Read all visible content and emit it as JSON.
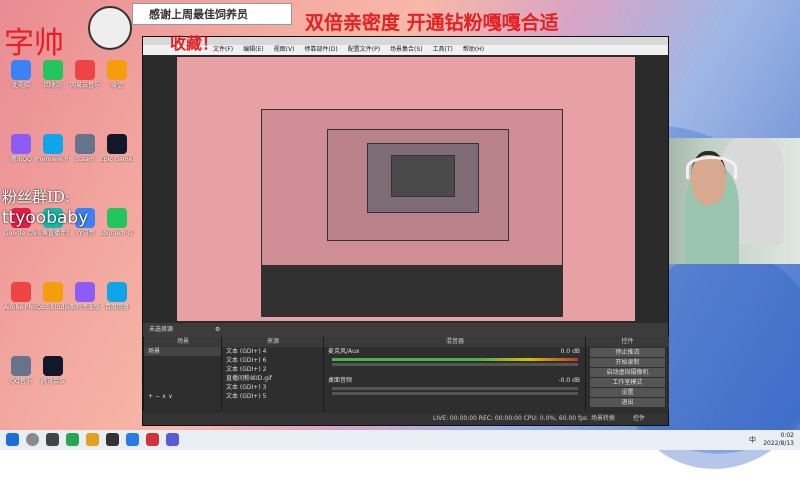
{
  "overlay": {
    "title": "双倍亲密度 开通钻粉嘎嘎合适",
    "banner": "感谢上周最佳饲养员",
    "zishuai": "字帅",
    "shoucang": "收藏！",
    "fans_label": "粉丝群ID:",
    "fans_id": "ttyoobaby"
  },
  "obs": {
    "menu": [
      "文件(F)",
      "编辑(E)",
      "视图(V)",
      "停靠部件(D)",
      "配置文件(P)",
      "场景集合(S)",
      "工具(T)",
      "帮助(H)"
    ],
    "controls_label": "未选择源",
    "scenes_header": "场景",
    "scenes": [
      "场景"
    ],
    "sources_header": "来源",
    "sources": [
      "文本 (GDI+) 4",
      "文本 (GDI+) 6",
      "文本 (GDI+) 2",
      "直播间粉丝ID.gif",
      "文本 (GDI+) 3",
      "文本 (GDI+) 5"
    ],
    "mixer_header": "混音器",
    "mixer": [
      {
        "name": "麦克风/Aux",
        "db": "0.0 dB"
      },
      {
        "name": "桌面音频",
        "db": "-0.0 dB"
      }
    ],
    "controls_header": "控件",
    "buttons": [
      "停止推流",
      "开始录制",
      "启动虚拟摄像机",
      "工作室模式",
      "设置",
      "退出"
    ],
    "status": "LIVE: 00:00:00   REC: 00:00:00   CPU: 0.0%, 60.00 fps",
    "bottom_tabs": [
      "场景转换",
      "控件"
    ]
  },
  "desktop_icons": [
    "此电脑",
    "回收站",
    "网易云音乐",
    "微信",
    "腾讯QQ",
    "Premiere Pro",
    "Steam",
    "Epic Games Launcher",
    "Google Chrome",
    "斗鱼直播伴侣",
    "YY语音",
    "Logitech G HUB",
    "Adobe Photoshop",
    "OBS Studio",
    "剪映专业版",
    "百度网盘",
    "QQ音乐",
    "腾讯会议"
  ],
  "taskbar": {
    "time": "0:02",
    "date": "2022/8/13",
    "lang": "中"
  },
  "colors": {
    "overlay_red": "#e52020",
    "obs_bg": "#2b2b2b",
    "meter_green": "#4caf50"
  }
}
